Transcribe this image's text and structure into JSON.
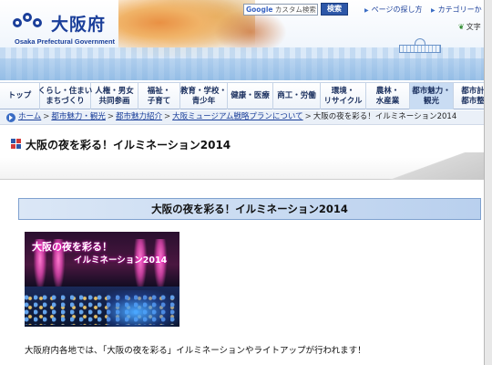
{
  "header": {
    "logo_jp": "大阪府",
    "logo_en": "Osaka Prefectural Government",
    "search_placeholder_google": "Google",
    "search_placeholder_text": "カスタム検索",
    "search_button": "検索",
    "links": [
      "ページの探し方",
      "カテゴリーか"
    ],
    "text_size_label": "文字"
  },
  "nav": {
    "items": [
      {
        "line1": "トップ",
        "line2": ""
      },
      {
        "line1": "くらし・住まい",
        "line2": "まちづくり"
      },
      {
        "line1": "人権・男女",
        "line2": "共同参画"
      },
      {
        "line1": "福祉・",
        "line2": "子育て"
      },
      {
        "line1": "教育・学校・",
        "line2": "青少年"
      },
      {
        "line1": "健康・医療",
        "line2": ""
      },
      {
        "line1": "商工・労働",
        "line2": ""
      },
      {
        "line1": "環境・",
        "line2": "リサイクル"
      },
      {
        "line1": "農林・",
        "line2": "水産業"
      },
      {
        "line1": "都市魅力・",
        "line2": "観光"
      },
      {
        "line1": "都市計",
        "line2": "都市整"
      }
    ]
  },
  "breadcrumb": {
    "items": [
      "ホーム",
      "都市魅力・観光",
      "都市魅力紹介",
      "大阪ミュージアム戦略プランについて"
    ],
    "current": "大阪の夜を彩る！イルミネーション2014"
  },
  "page": {
    "title": "大阪の夜を彩る！イルミネーション2014",
    "section_heading": "大阪の夜を彩る！イルミネーション2014",
    "image_caption_line1": "大阪の夜を彩る！",
    "image_caption_line2": "イルミネーション2014",
    "body_text": "大阪府内各地では、「大阪の夜を彩る」イルミネーションやライトアップが行われます！"
  },
  "colors": {
    "brand_blue": "#1b3f9a",
    "nav_active": "#c9dcf3",
    "section_bar": "#b9d0ee"
  }
}
